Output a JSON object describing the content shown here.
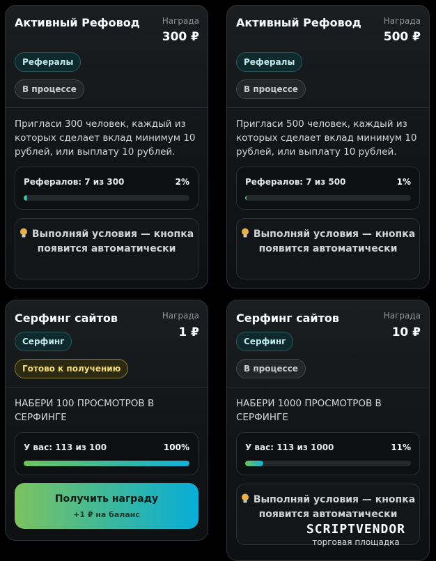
{
  "reward_label": "Награда",
  "cards": [
    {
      "title": "Активный Рефовод",
      "reward": "300 ₽",
      "category": "Рефералы",
      "status": "В процессе",
      "description": "Пригласи 300 человек, каждый из которых сделает вклад минимум 10 рублей, или выплату 10 рублей.",
      "progress_label": "Рефералов: 7 из 300",
      "progress_percent": "2%",
      "progress_value": 0.02,
      "hint": "Выполняй условия — кнопка появится автоматически"
    },
    {
      "title": "Активный Рефовод",
      "reward": "500 ₽",
      "category": "Рефералы",
      "status": "В процессе",
      "description": "Пригласи 500 человек, каждый из которых сделает вклад минимум 10 рублей, или выплату 10 рублей.",
      "progress_label": "Рефералов: 7 из 500",
      "progress_percent": "1%",
      "progress_value": 0.01,
      "hint": "Выполняй условия — кнопка появится автоматически"
    },
    {
      "title": "Серфинг сайтов",
      "reward": "1 ₽",
      "category": "Серфинг",
      "status": "Готово к получению",
      "description": "НАБЕРИ 100 ПРОСМОТРОВ В СЕРФИНГЕ",
      "progress_label": "У вас: 113 из 100",
      "progress_percent": "100%",
      "progress_value": 1.0,
      "claim_label": "Получить награду",
      "claim_sub": "+1 ₽ на баланс"
    },
    {
      "title": "Серфинг сайтов",
      "reward": "10 ₽",
      "category": "Серфинг",
      "status": "В процессе",
      "description": "НАБЕРИ 1000 ПРОСМОТРОВ В СЕРФИНГЕ",
      "progress_label": "У вас: 113 из 1000",
      "progress_percent": "11%",
      "progress_value": 0.11,
      "hint": "Выполняй условия — кнопка появится автоматически"
    }
  ],
  "watermark": {
    "main": "SCRIPTVENDOR",
    "sub": "торговая площадка"
  }
}
